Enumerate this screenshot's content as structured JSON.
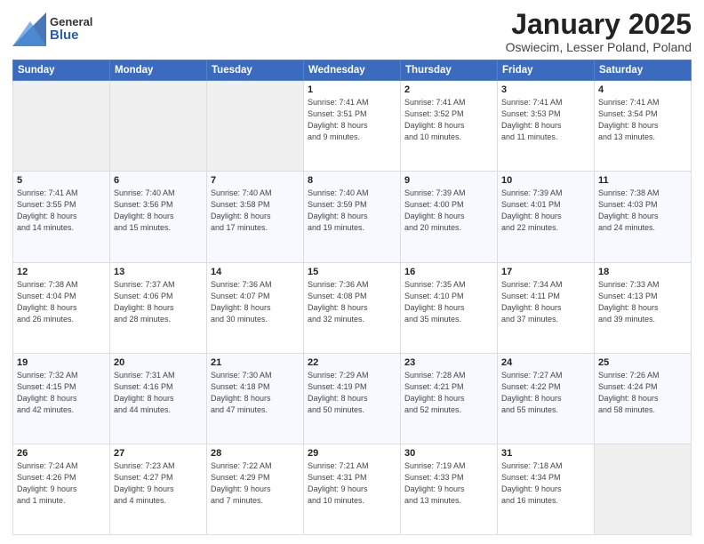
{
  "logo": {
    "general": "General",
    "blue": "Blue"
  },
  "title": "January 2025",
  "subtitle": "Oswiecim, Lesser Poland, Poland",
  "days_header": [
    "Sunday",
    "Monday",
    "Tuesday",
    "Wednesday",
    "Thursday",
    "Friday",
    "Saturday"
  ],
  "weeks": [
    [
      {
        "day": "",
        "detail": ""
      },
      {
        "day": "",
        "detail": ""
      },
      {
        "day": "",
        "detail": ""
      },
      {
        "day": "1",
        "detail": "Sunrise: 7:41 AM\nSunset: 3:51 PM\nDaylight: 8 hours\nand 9 minutes."
      },
      {
        "day": "2",
        "detail": "Sunrise: 7:41 AM\nSunset: 3:52 PM\nDaylight: 8 hours\nand 10 minutes."
      },
      {
        "day": "3",
        "detail": "Sunrise: 7:41 AM\nSunset: 3:53 PM\nDaylight: 8 hours\nand 11 minutes."
      },
      {
        "day": "4",
        "detail": "Sunrise: 7:41 AM\nSunset: 3:54 PM\nDaylight: 8 hours\nand 13 minutes."
      }
    ],
    [
      {
        "day": "5",
        "detail": "Sunrise: 7:41 AM\nSunset: 3:55 PM\nDaylight: 8 hours\nand 14 minutes."
      },
      {
        "day": "6",
        "detail": "Sunrise: 7:40 AM\nSunset: 3:56 PM\nDaylight: 8 hours\nand 15 minutes."
      },
      {
        "day": "7",
        "detail": "Sunrise: 7:40 AM\nSunset: 3:58 PM\nDaylight: 8 hours\nand 17 minutes."
      },
      {
        "day": "8",
        "detail": "Sunrise: 7:40 AM\nSunset: 3:59 PM\nDaylight: 8 hours\nand 19 minutes."
      },
      {
        "day": "9",
        "detail": "Sunrise: 7:39 AM\nSunset: 4:00 PM\nDaylight: 8 hours\nand 20 minutes."
      },
      {
        "day": "10",
        "detail": "Sunrise: 7:39 AM\nSunset: 4:01 PM\nDaylight: 8 hours\nand 22 minutes."
      },
      {
        "day": "11",
        "detail": "Sunrise: 7:38 AM\nSunset: 4:03 PM\nDaylight: 8 hours\nand 24 minutes."
      }
    ],
    [
      {
        "day": "12",
        "detail": "Sunrise: 7:38 AM\nSunset: 4:04 PM\nDaylight: 8 hours\nand 26 minutes."
      },
      {
        "day": "13",
        "detail": "Sunrise: 7:37 AM\nSunset: 4:06 PM\nDaylight: 8 hours\nand 28 minutes."
      },
      {
        "day": "14",
        "detail": "Sunrise: 7:36 AM\nSunset: 4:07 PM\nDaylight: 8 hours\nand 30 minutes."
      },
      {
        "day": "15",
        "detail": "Sunrise: 7:36 AM\nSunset: 4:08 PM\nDaylight: 8 hours\nand 32 minutes."
      },
      {
        "day": "16",
        "detail": "Sunrise: 7:35 AM\nSunset: 4:10 PM\nDaylight: 8 hours\nand 35 minutes."
      },
      {
        "day": "17",
        "detail": "Sunrise: 7:34 AM\nSunset: 4:11 PM\nDaylight: 8 hours\nand 37 minutes."
      },
      {
        "day": "18",
        "detail": "Sunrise: 7:33 AM\nSunset: 4:13 PM\nDaylight: 8 hours\nand 39 minutes."
      }
    ],
    [
      {
        "day": "19",
        "detail": "Sunrise: 7:32 AM\nSunset: 4:15 PM\nDaylight: 8 hours\nand 42 minutes."
      },
      {
        "day": "20",
        "detail": "Sunrise: 7:31 AM\nSunset: 4:16 PM\nDaylight: 8 hours\nand 44 minutes."
      },
      {
        "day": "21",
        "detail": "Sunrise: 7:30 AM\nSunset: 4:18 PM\nDaylight: 8 hours\nand 47 minutes."
      },
      {
        "day": "22",
        "detail": "Sunrise: 7:29 AM\nSunset: 4:19 PM\nDaylight: 8 hours\nand 50 minutes."
      },
      {
        "day": "23",
        "detail": "Sunrise: 7:28 AM\nSunset: 4:21 PM\nDaylight: 8 hours\nand 52 minutes."
      },
      {
        "day": "24",
        "detail": "Sunrise: 7:27 AM\nSunset: 4:22 PM\nDaylight: 8 hours\nand 55 minutes."
      },
      {
        "day": "25",
        "detail": "Sunrise: 7:26 AM\nSunset: 4:24 PM\nDaylight: 8 hours\nand 58 minutes."
      }
    ],
    [
      {
        "day": "26",
        "detail": "Sunrise: 7:24 AM\nSunset: 4:26 PM\nDaylight: 9 hours\nand 1 minute."
      },
      {
        "day": "27",
        "detail": "Sunrise: 7:23 AM\nSunset: 4:27 PM\nDaylight: 9 hours\nand 4 minutes."
      },
      {
        "day": "28",
        "detail": "Sunrise: 7:22 AM\nSunset: 4:29 PM\nDaylight: 9 hours\nand 7 minutes."
      },
      {
        "day": "29",
        "detail": "Sunrise: 7:21 AM\nSunset: 4:31 PM\nDaylight: 9 hours\nand 10 minutes."
      },
      {
        "day": "30",
        "detail": "Sunrise: 7:19 AM\nSunset: 4:33 PM\nDaylight: 9 hours\nand 13 minutes."
      },
      {
        "day": "31",
        "detail": "Sunrise: 7:18 AM\nSunset: 4:34 PM\nDaylight: 9 hours\nand 16 minutes."
      },
      {
        "day": "",
        "detail": ""
      }
    ]
  ]
}
